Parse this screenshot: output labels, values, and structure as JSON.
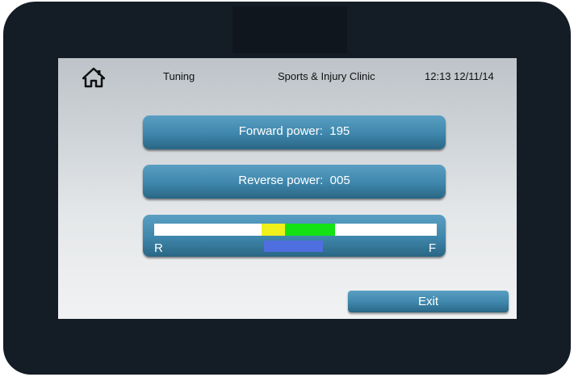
{
  "header": {
    "home_icon": "home-icon",
    "title": "Tuning",
    "clinic": "Sports & Injury Clinic",
    "datetime": "12:13  12/11/14"
  },
  "forward": {
    "label": "Forward power:",
    "value": "195"
  },
  "reverse": {
    "label": "Reverse power:",
    "value": "005"
  },
  "meter": {
    "left_label": "R",
    "right_label": "F",
    "colors": {
      "yellow": "#f0f01a",
      "green": "#14e214",
      "indicator": "#4f6ee0"
    }
  },
  "exit_label": "Exit",
  "colors": {
    "button": "#3e86ab",
    "bezel": "#141c25"
  }
}
